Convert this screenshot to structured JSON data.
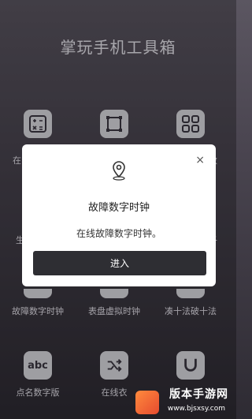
{
  "app": {
    "title": "掌玩手机工具箱"
  },
  "tools": {
    "row1": [
      {
        "icon_name": "calculator-icon"
      },
      {
        "icon_name": "frame-icon"
      },
      {
        "icon_name": "grid-icon"
      }
    ],
    "row1_partial_labels": {
      "left": "在",
      "right": "数"
    },
    "row2_partial_labels": {
      "left": "生",
      "right": "子"
    },
    "row3_labels": [
      "故障数字时钟",
      "表盘虚拟时钟",
      "凑十法破十法"
    ],
    "row4": [
      {
        "icon_text": "abc",
        "label": "点名数字版",
        "icon_name": "abc-icon"
      },
      {
        "label": "在线衣",
        "icon_name": "shuffle-icon"
      },
      {
        "icon_name": "magnet-icon"
      }
    ]
  },
  "dialog": {
    "title": "故障数字时钟",
    "description": "在线故障数字时钟。",
    "enter_label": "进入",
    "close_symbol": "×",
    "icon_name": "location-pin-icon"
  },
  "watermark": {
    "text": "版本手游网",
    "url": "www.bjsxsy.com"
  }
}
